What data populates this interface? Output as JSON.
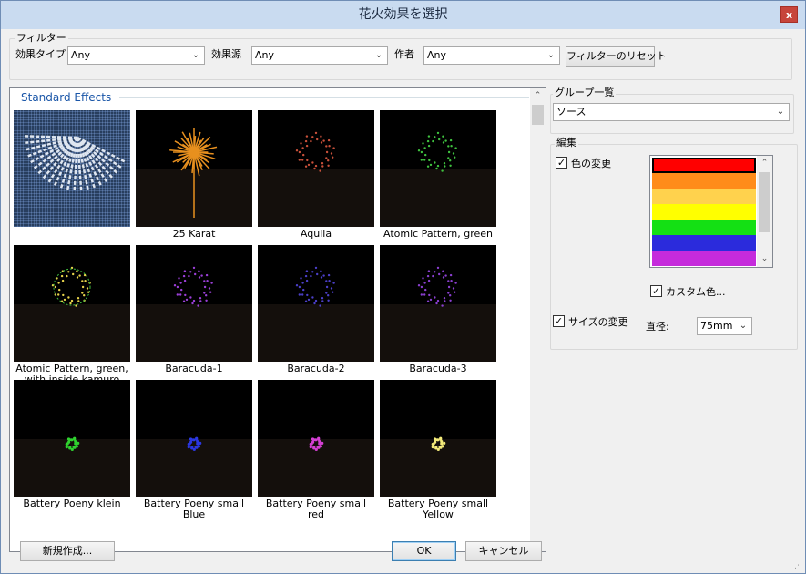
{
  "window": {
    "title": "花火効果を選択",
    "close_label": "x"
  },
  "filter": {
    "legend": "フィルター",
    "effect_type_label": "効果タイプ",
    "effect_type_value": "Any",
    "effect_source_label": "効果源",
    "effect_source_value": "Any",
    "author_label": "作者",
    "author_value": "Any",
    "reset_button": "フィルターのリセット"
  },
  "gallery": {
    "group_header": "Standard Effects",
    "items": [
      {
        "name": "",
        "icon": "selected-pattern-icon"
      },
      {
        "name": "25 Karat",
        "icon": "firework-icon",
        "color": "#e8901f"
      },
      {
        "name": "Aquila",
        "icon": "firework-icon",
        "color": "#c8503a"
      },
      {
        "name": "Atomic Pattern, green",
        "icon": "firework-icon",
        "color": "#3fc13f"
      },
      {
        "name": "Atomic Pattern, green, with inside kamuro",
        "icon": "firework-icon",
        "color": "#e6d24a"
      },
      {
        "name": "Baracuda-1",
        "icon": "firework-icon",
        "color": "#9b3fd8"
      },
      {
        "name": "Baracuda-2",
        "icon": "firework-icon",
        "color": "#4b3fc8"
      },
      {
        "name": "Baracuda-3",
        "icon": "firework-icon",
        "color": "#8a3fd0"
      },
      {
        "name": "Battery Poeny klein",
        "icon": "firework-icon",
        "color": "#2fd12f"
      },
      {
        "name": "Battery Poeny small Blue",
        "icon": "firework-icon",
        "color": "#2b37e0"
      },
      {
        "name": "Battery Poeny small red",
        "icon": "firework-icon",
        "color": "#d33fd3"
      },
      {
        "name": "Battery Poeny small Yellow",
        "icon": "firework-icon",
        "color": "#f3ea7a"
      }
    ]
  },
  "group_list": {
    "label": "グループ一覧",
    "value": "ソース"
  },
  "edit": {
    "legend": "編集",
    "change_color_label": "色の変更",
    "change_color_checked": true,
    "colors": [
      "#ff0000",
      "#ff8c1a",
      "#ffd24d",
      "#ffff00",
      "#14e014",
      "#2b2bdc",
      "#c52bdc"
    ],
    "custom_color_label": "カスタム色...",
    "custom_color_checked": true,
    "change_size_label": "サイズの変更",
    "change_size_checked": true,
    "diameter_label": "直径:",
    "diameter_value": "75mm"
  },
  "buttons": {
    "new": "新規作成...",
    "ok": "OK",
    "cancel": "キャンセル"
  }
}
